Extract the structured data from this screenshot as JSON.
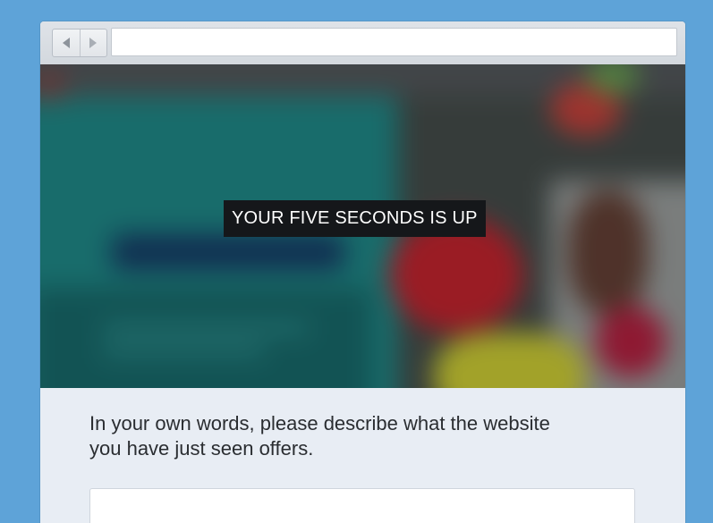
{
  "browser": {
    "address_value": ""
  },
  "viewport": {
    "banner_text": "YOUR FIVE SECONDS IS UP"
  },
  "survey": {
    "question_line1": "In your own words, please describe what the website",
    "question_line2": "you have just seen offers.",
    "answer_value": ""
  },
  "colors": {
    "background": "#5ea3d8",
    "panel": "#e8edf4",
    "banner_bg": "#15171a"
  },
  "icons": {
    "back": "left-triangle",
    "forward": "right-triangle"
  }
}
